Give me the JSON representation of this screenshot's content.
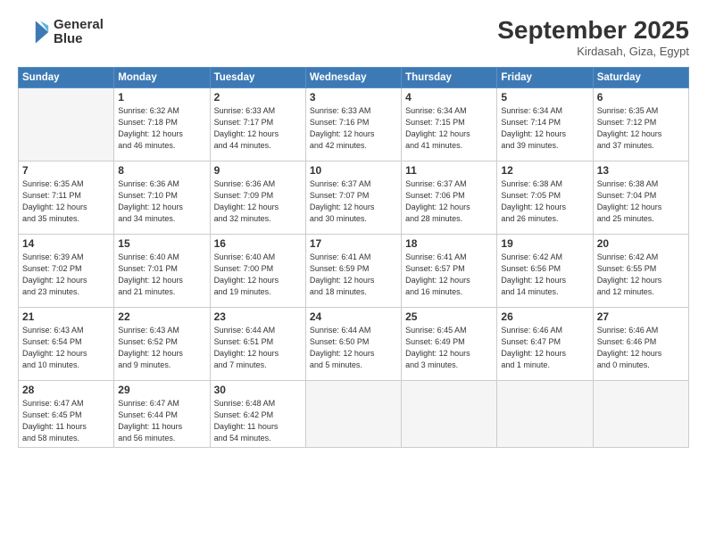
{
  "header": {
    "logo_line1": "General",
    "logo_line2": "Blue",
    "month": "September 2025",
    "location": "Kirdasah, Giza, Egypt"
  },
  "weekdays": [
    "Sunday",
    "Monday",
    "Tuesday",
    "Wednesday",
    "Thursday",
    "Friday",
    "Saturday"
  ],
  "weeks": [
    [
      {
        "day": "",
        "info": ""
      },
      {
        "day": "1",
        "info": "Sunrise: 6:32 AM\nSunset: 7:18 PM\nDaylight: 12 hours\nand 46 minutes."
      },
      {
        "day": "2",
        "info": "Sunrise: 6:33 AM\nSunset: 7:17 PM\nDaylight: 12 hours\nand 44 minutes."
      },
      {
        "day": "3",
        "info": "Sunrise: 6:33 AM\nSunset: 7:16 PM\nDaylight: 12 hours\nand 42 minutes."
      },
      {
        "day": "4",
        "info": "Sunrise: 6:34 AM\nSunset: 7:15 PM\nDaylight: 12 hours\nand 41 minutes."
      },
      {
        "day": "5",
        "info": "Sunrise: 6:34 AM\nSunset: 7:14 PM\nDaylight: 12 hours\nand 39 minutes."
      },
      {
        "day": "6",
        "info": "Sunrise: 6:35 AM\nSunset: 7:12 PM\nDaylight: 12 hours\nand 37 minutes."
      }
    ],
    [
      {
        "day": "7",
        "info": "Sunrise: 6:35 AM\nSunset: 7:11 PM\nDaylight: 12 hours\nand 35 minutes."
      },
      {
        "day": "8",
        "info": "Sunrise: 6:36 AM\nSunset: 7:10 PM\nDaylight: 12 hours\nand 34 minutes."
      },
      {
        "day": "9",
        "info": "Sunrise: 6:36 AM\nSunset: 7:09 PM\nDaylight: 12 hours\nand 32 minutes."
      },
      {
        "day": "10",
        "info": "Sunrise: 6:37 AM\nSunset: 7:07 PM\nDaylight: 12 hours\nand 30 minutes."
      },
      {
        "day": "11",
        "info": "Sunrise: 6:37 AM\nSunset: 7:06 PM\nDaylight: 12 hours\nand 28 minutes."
      },
      {
        "day": "12",
        "info": "Sunrise: 6:38 AM\nSunset: 7:05 PM\nDaylight: 12 hours\nand 26 minutes."
      },
      {
        "day": "13",
        "info": "Sunrise: 6:38 AM\nSunset: 7:04 PM\nDaylight: 12 hours\nand 25 minutes."
      }
    ],
    [
      {
        "day": "14",
        "info": "Sunrise: 6:39 AM\nSunset: 7:02 PM\nDaylight: 12 hours\nand 23 minutes."
      },
      {
        "day": "15",
        "info": "Sunrise: 6:40 AM\nSunset: 7:01 PM\nDaylight: 12 hours\nand 21 minutes."
      },
      {
        "day": "16",
        "info": "Sunrise: 6:40 AM\nSunset: 7:00 PM\nDaylight: 12 hours\nand 19 minutes."
      },
      {
        "day": "17",
        "info": "Sunrise: 6:41 AM\nSunset: 6:59 PM\nDaylight: 12 hours\nand 18 minutes."
      },
      {
        "day": "18",
        "info": "Sunrise: 6:41 AM\nSunset: 6:57 PM\nDaylight: 12 hours\nand 16 minutes."
      },
      {
        "day": "19",
        "info": "Sunrise: 6:42 AM\nSunset: 6:56 PM\nDaylight: 12 hours\nand 14 minutes."
      },
      {
        "day": "20",
        "info": "Sunrise: 6:42 AM\nSunset: 6:55 PM\nDaylight: 12 hours\nand 12 minutes."
      }
    ],
    [
      {
        "day": "21",
        "info": "Sunrise: 6:43 AM\nSunset: 6:54 PM\nDaylight: 12 hours\nand 10 minutes."
      },
      {
        "day": "22",
        "info": "Sunrise: 6:43 AM\nSunset: 6:52 PM\nDaylight: 12 hours\nand 9 minutes."
      },
      {
        "day": "23",
        "info": "Sunrise: 6:44 AM\nSunset: 6:51 PM\nDaylight: 12 hours\nand 7 minutes."
      },
      {
        "day": "24",
        "info": "Sunrise: 6:44 AM\nSunset: 6:50 PM\nDaylight: 12 hours\nand 5 minutes."
      },
      {
        "day": "25",
        "info": "Sunrise: 6:45 AM\nSunset: 6:49 PM\nDaylight: 12 hours\nand 3 minutes."
      },
      {
        "day": "26",
        "info": "Sunrise: 6:46 AM\nSunset: 6:47 PM\nDaylight: 12 hours\nand 1 minute."
      },
      {
        "day": "27",
        "info": "Sunrise: 6:46 AM\nSunset: 6:46 PM\nDaylight: 12 hours\nand 0 minutes."
      }
    ],
    [
      {
        "day": "28",
        "info": "Sunrise: 6:47 AM\nSunset: 6:45 PM\nDaylight: 11 hours\nand 58 minutes."
      },
      {
        "day": "29",
        "info": "Sunrise: 6:47 AM\nSunset: 6:44 PM\nDaylight: 11 hours\nand 56 minutes."
      },
      {
        "day": "30",
        "info": "Sunrise: 6:48 AM\nSunset: 6:42 PM\nDaylight: 11 hours\nand 54 minutes."
      },
      {
        "day": "",
        "info": ""
      },
      {
        "day": "",
        "info": ""
      },
      {
        "day": "",
        "info": ""
      },
      {
        "day": "",
        "info": ""
      }
    ]
  ]
}
